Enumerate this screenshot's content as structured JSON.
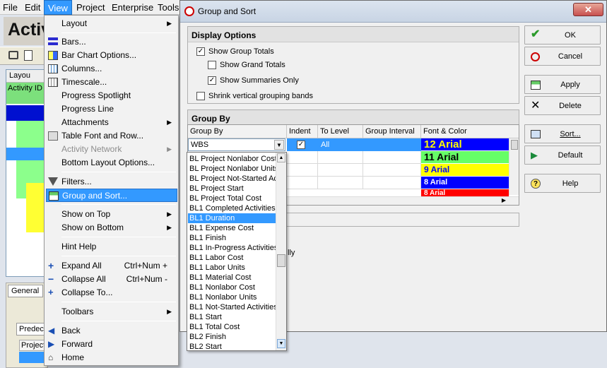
{
  "menubar": {
    "items": [
      "File",
      "Edit",
      "View",
      "Project",
      "Enterprise",
      "Tools"
    ]
  },
  "app": {
    "title": "Activ",
    "layout_label": "Layou",
    "activity_id_header": "Activity ID",
    "bottom_tab": "General",
    "bottom_sub": "Predec",
    "bottom_col": "Project"
  },
  "view_menu": {
    "items": [
      {
        "label": "Layout",
        "submenu": true,
        "icon": "none"
      },
      {
        "label": "Bars...",
        "icon": "bars-icon"
      },
      {
        "label": "Bar Chart Options...",
        "icon": "bar-chart-options-icon"
      },
      {
        "label": "Columns...",
        "icon": "columns-icon"
      },
      {
        "label": "Timescale...",
        "icon": "timescale-icon"
      },
      {
        "label": "Progress Spotlight",
        "icon": "none"
      },
      {
        "label": "Progress Line",
        "icon": "none"
      },
      {
        "label": "Attachments",
        "submenu": true,
        "icon": "none"
      },
      {
        "label": "Table Font and Row...",
        "icon": "table-font-icon"
      },
      {
        "label": "Activity Network",
        "submenu": true,
        "disabled": true,
        "icon": "none"
      },
      {
        "label": "Bottom Layout Options...",
        "icon": "none"
      },
      {
        "label": "Filters...",
        "icon": "filter-icon"
      },
      {
        "label": "Group and Sort...",
        "icon": "group-sort-icon",
        "highlighted": true
      },
      {
        "label": "Show on Top",
        "submenu": true,
        "icon": "none"
      },
      {
        "label": "Show on Bottom",
        "submenu": true,
        "icon": "none"
      },
      {
        "label": "Hint Help",
        "icon": "none"
      },
      {
        "label": "Expand All",
        "shortcut": "Ctrl+Num +",
        "icon": "expand-all-icon"
      },
      {
        "label": "Collapse All",
        "shortcut": "Ctrl+Num -",
        "icon": "collapse-all-icon"
      },
      {
        "label": "Collapse To...",
        "icon": "collapse-to-icon"
      },
      {
        "label": "Toolbars",
        "submenu": true,
        "icon": "none"
      },
      {
        "label": "Back",
        "icon": "back-icon"
      },
      {
        "label": "Forward",
        "icon": "forward-icon"
      },
      {
        "label": "Home",
        "icon": "home-icon"
      }
    ]
  },
  "dialog": {
    "title": "Group and Sort",
    "close": "✕",
    "display_options": {
      "title": "Display Options",
      "show_group_totals": "Show Group Totals",
      "show_grand_totals": "Show Grand Totals",
      "show_summaries_only": "Show Summaries Only",
      "shrink_bands": "Shrink vertical grouping bands"
    },
    "group_by": {
      "title": "Group By",
      "headers": [
        "Group By",
        "Indent",
        "To Level",
        "Group Interval",
        "Font & Color"
      ],
      "current_value": "WBS",
      "to_level": "All",
      "font_rows": [
        {
          "label": "12 Arial",
          "bg": "#0000ff",
          "fg": "#ffff00"
        },
        {
          "label": "11 Arial",
          "bg": "#66ff66",
          "fg": "#000000"
        },
        {
          "label": "9 Arial",
          "bg": "#ffff00",
          "fg": "#0000ff"
        },
        {
          "label": "8 Arial",
          "bg": "#0000ff",
          "fg": "#ffffff"
        },
        {
          "label": "8 Arial",
          "bg": "#ff0000",
          "fg": "#ffffff"
        }
      ]
    },
    "hidden_text": "lly",
    "buttons": {
      "ok": "OK",
      "cancel": "Cancel",
      "apply": "Apply",
      "delete": "Delete",
      "sort": "Sort...",
      "default": "Default",
      "help": "Help"
    }
  },
  "dropdown_options": [
    "BL Project Nonlabor Cost",
    "BL Project Nonlabor Units",
    "BL Project Not-Started Activities",
    "BL Project Start",
    "BL Project Total Cost",
    "BL1 Completed Activities",
    "BL1 Duration",
    "BL1 Expense Cost",
    "BL1 Finish",
    "BL1 In-Progress Activities",
    "BL1 Labor Cost",
    "BL1 Labor Units",
    "BL1 Material Cost",
    "BL1 Nonlabor Cost",
    "BL1 Nonlabor Units",
    "BL1 Not-Started Activities",
    "BL1 Start",
    "BL1 Total Cost",
    "BL2 Finish",
    "BL2 Start"
  ],
  "dropdown_selected": "BL1 Duration"
}
